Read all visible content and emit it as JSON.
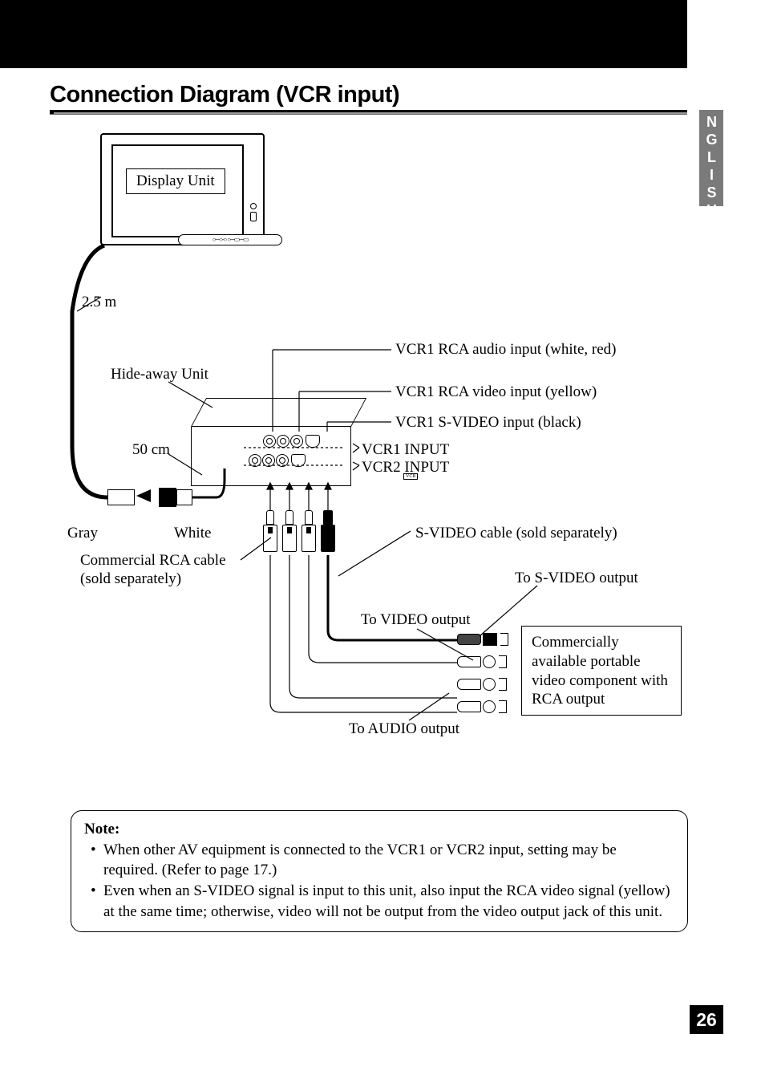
{
  "lang_tab": "ENGLISH",
  "section_title": "Connection Diagram (VCR input)",
  "diagram": {
    "display_unit_label": "Display Unit",
    "cable_25m": "2.5 m",
    "hideaway_label": "Hide-away Unit",
    "cable_50cm": "50 cm",
    "gray": "Gray",
    "white": "White",
    "commercial_rca": "Commercial RCA cable (sold separately)",
    "vcr1_audio": "VCR1 RCA audio input (white, red)",
    "vcr1_video": "VCR1 RCA video input (yellow)",
    "vcr1_svideo": "VCR1 S-VIDEO input (black)",
    "vcr1_input": "VCR1 INPUT",
    "vcr2_input": "VCR2 INPUT",
    "svideo_cable": "S-VIDEO cable (sold separately)",
    "to_svideo": "To S-VIDEO output",
    "to_video": "To VIDEO output",
    "to_audio": "To AUDIO output",
    "pvc_text": "Commercially available portable video component with RCA output"
  },
  "note": {
    "heading": "Note:",
    "items": [
      "When other AV equipment is connected to the VCR1 or VCR2 input, setting may be required. (Refer to page 17.)",
      "Even when an S-VIDEO signal is input to this unit, also input the RCA video signal (yellow) at the same time; otherwise, video will not be output from the video output jack of this unit."
    ]
  },
  "page_number": "26"
}
